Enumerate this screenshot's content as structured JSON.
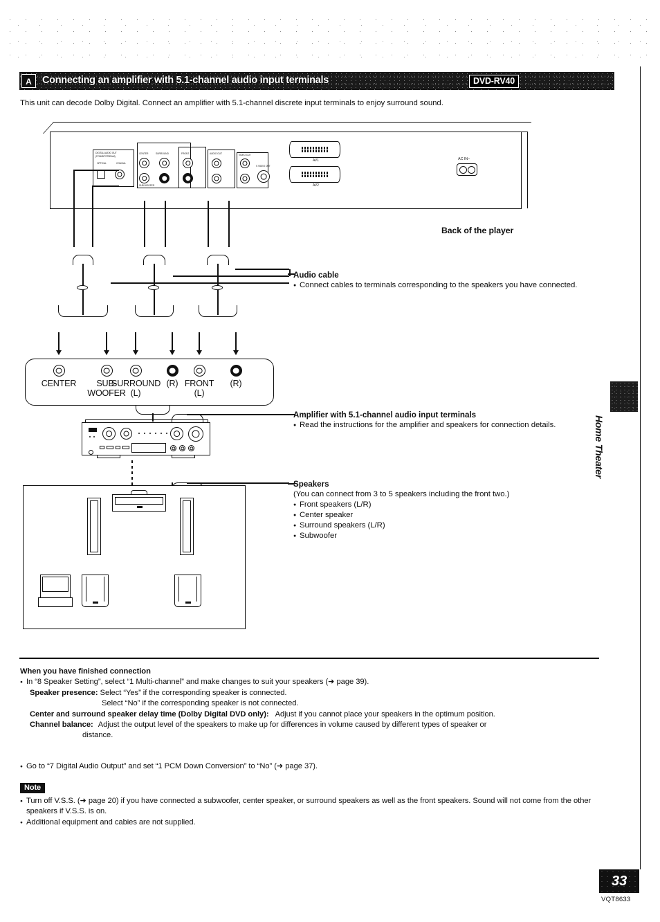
{
  "header": {
    "letter": "A",
    "title": "Connecting an amplifier with 5.1-channel audio input terminals",
    "model_badge": "DVD-RV40"
  },
  "intro": "This unit can decode Dolby Digital. Connect an amplifier with 5.1-channel discrete input terminals to enjoy surround sound.",
  "diagram": {
    "back_of_player_label": "Back of the player",
    "rear_panel": {
      "digital_audio_out": "DIGITAL AUDIO OUT",
      "digital_audio_out_sub": "(PCM/BITSTREAM)",
      "optical": "OPTICAL",
      "coaxial": "COAXIAL",
      "center_label": "CENTER",
      "surround_label": "SURROUND",
      "front_label": "FRONT",
      "audio_out_label": "AUDIO OUT",
      "video_out_label": "VIDEO OUT",
      "s_video_out_label": "S VIDEO OUT",
      "subwoofer_label": "SUB WOOFER",
      "scart1": "AV1",
      "scart2": "AV2",
      "ac_in": "AC IN~"
    },
    "terminals": [
      {
        "name": "CENTER",
        "line2": "",
        "filled": false
      },
      {
        "name": "SUB-",
        "line2": "WOOFER",
        "filled": false
      },
      {
        "name": "SURROUND",
        "line2": "(L)",
        "filled": false
      },
      {
        "name": "",
        "line2": "(R)",
        "filled": true
      },
      {
        "name": "FRONT",
        "line2": "(L)",
        "filled": false
      },
      {
        "name": "",
        "line2": "(R)",
        "filled": true
      }
    ]
  },
  "annotations": {
    "audio_cable": {
      "title": "Audio cable",
      "bullets": [
        "Connect cables to terminals corresponding to the speakers you have connected."
      ]
    },
    "amplifier": {
      "title": "Amplifier with 5.1-channel audio input terminals",
      "bullets": [
        "Read the instructions for the amplifier and speakers for connection details."
      ]
    },
    "speakers": {
      "title": "Speakers",
      "note": "(You can connect from 3 to 5 speakers including the front two.)",
      "bullets": [
        "Front speakers (L/R)",
        "Center speaker",
        "Surround speakers (L/R)",
        "Subwoofer"
      ]
    }
  },
  "side_tab": {
    "label": "Home Theater"
  },
  "finished": {
    "heading": "When you have finished connection",
    "bullet1": "In “8 Speaker Setting”, select “1 Multi-channel” and make changes to suit your speakers (➜ page 39).",
    "speaker_presence_label": "Speaker presence:",
    "speaker_presence_line1": "Select “Yes” if the corresponding speaker is connected.",
    "speaker_presence_line2": "Select “No” if the corresponding speaker is not connected.",
    "delay_label": "Center and surround speaker delay time (Dolby Digital DVD only):",
    "delay_text": "Adjust if you cannot place your speakers in the optimum position.",
    "balance_label": "Channel balance:",
    "balance_text": "Adjust the output level of the speakers to make up for differences in volume caused by different types of speaker or",
    "balance_text2": "distance.",
    "bullet2": "Go to “7 Digital Audio Output” and set “1 PCM Down Conversion” to “No” (➜ page 37)."
  },
  "note": {
    "label": "Note",
    "items": [
      "Turn off V.S.S. (➜ page 20) if you have connected a subwoofer, center speaker, or surround speakers as well as the front speakers. Sound will not come from the other speakers if V.S.S. is on.",
      "Additional equipment and cabies are not supplied."
    ]
  },
  "footer": {
    "page_number": "33",
    "doc_code": "VQT8633"
  }
}
